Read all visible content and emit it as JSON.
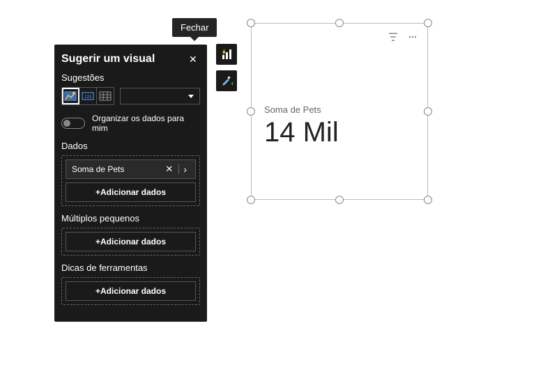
{
  "tooltip": {
    "close": "Fechar"
  },
  "panel": {
    "title": "Sugerir um visual",
    "sections": {
      "suggestions": "Sugestões",
      "organize": "Organizar os dados para mim",
      "data": "Dados",
      "small_multiples": "Múltiplos pequenos",
      "tooltips": "Dicas de ferramentas"
    },
    "field": {
      "name": "Soma de Pets"
    },
    "add_button": "+Adicionar dados"
  },
  "visual": {
    "label": "Soma de Pets",
    "value": "14 Mil"
  }
}
